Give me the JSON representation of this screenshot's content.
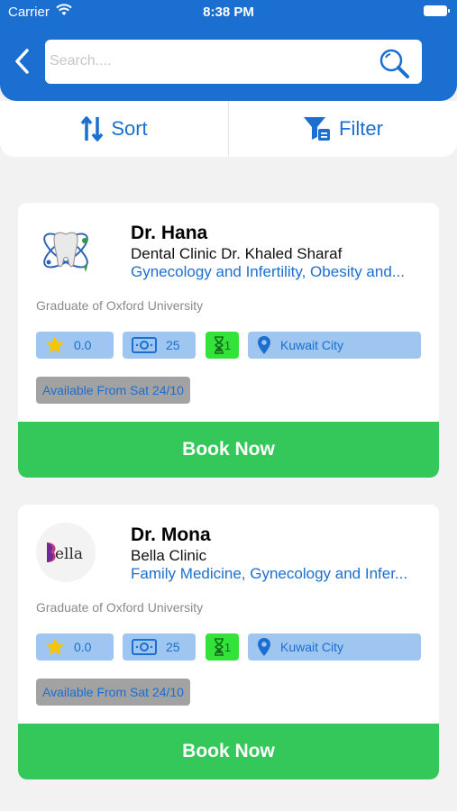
{
  "status_bar": {
    "carrier": "Carrier",
    "time": "8:38 PM"
  },
  "search": {
    "placeholder": "Search...."
  },
  "toolbar": {
    "sort_label": "Sort",
    "filter_label": "Filter"
  },
  "colors": {
    "primary": "#1a6fd0",
    "book": "#34c759",
    "wait": "#33e33a",
    "pill": "#9ec6f0",
    "available": "#a2a2a2"
  },
  "doctors": [
    {
      "name": "Dr. Hana",
      "clinic": "Dental Clinic Dr. Khaled Sharaf",
      "specialties": "Gynecology and Infertility, Obesity and...",
      "graduate": "Graduate of Oxford University",
      "rating": "0.0",
      "fee": "25",
      "wait": "1",
      "city": "Kuwait City",
      "available": "Available From Sat 24/10",
      "book_label": "Book Now",
      "avatar_icon": "tooth-logo-icon"
    },
    {
      "name": "Dr. Mona",
      "clinic": "Bella Clinic",
      "specialties": "Family Medicine, Gynecology and Infer...",
      "graduate": "Graduate of Oxford University",
      "rating": "0.0",
      "fee": "25",
      "wait": "1",
      "city": "Kuwait City",
      "available": "Available From Sat 24/10",
      "book_label": "Book Now",
      "avatar_icon": "bella-logo-icon",
      "avatar_logo_text": "ella"
    }
  ]
}
